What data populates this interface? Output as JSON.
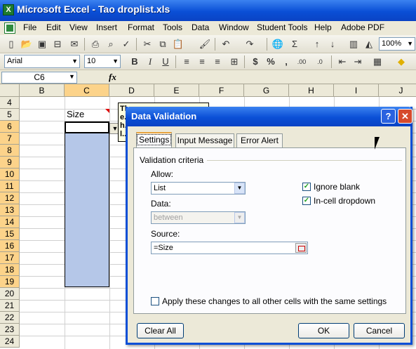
{
  "window": {
    "title": "Microsoft Excel - Tao droplist.xls"
  },
  "menu": [
    "File",
    "Edit",
    "View",
    "Insert",
    "Format",
    "Tools",
    "Data",
    "Window",
    "Student Tools",
    "Help",
    "Adobe PDF"
  ],
  "toolbar": {
    "zoom": "100%",
    "font": "Arial",
    "font_size": "10"
  },
  "formula_bar": {
    "name_box": "C6",
    "fx": "fx"
  },
  "grid": {
    "columns": [
      "B",
      "C",
      "D",
      "E",
      "F",
      "G",
      "H",
      "I",
      "J"
    ],
    "rows": [
      "4",
      "5",
      "6",
      "7",
      "8",
      "9",
      "10",
      "11",
      "12",
      "13",
      "14",
      "15",
      "16",
      "17",
      "18",
      "19",
      "20",
      "21",
      "22",
      "23",
      "24"
    ],
    "c5": "Size",
    "comment": "Th...\ne...\nh...\nl..."
  },
  "dialog": {
    "title": "Data Validation",
    "help_label": "?",
    "close_label": "✕",
    "tabs": [
      "Settings",
      "Input Message",
      "Error Alert"
    ],
    "section": "Validation criteria",
    "allow_label": "Allow:",
    "allow_value": "List",
    "data_label": "Data:",
    "data_value": "between",
    "source_label": "Source:",
    "source_value": "=Size",
    "ignore_blank": "Ignore blank",
    "in_cell_dropdown": "In-cell dropdown",
    "apply_all": "Apply these changes to all other cells with the same settings",
    "clear_all": "Clear All",
    "ok": "OK",
    "cancel": "Cancel"
  }
}
